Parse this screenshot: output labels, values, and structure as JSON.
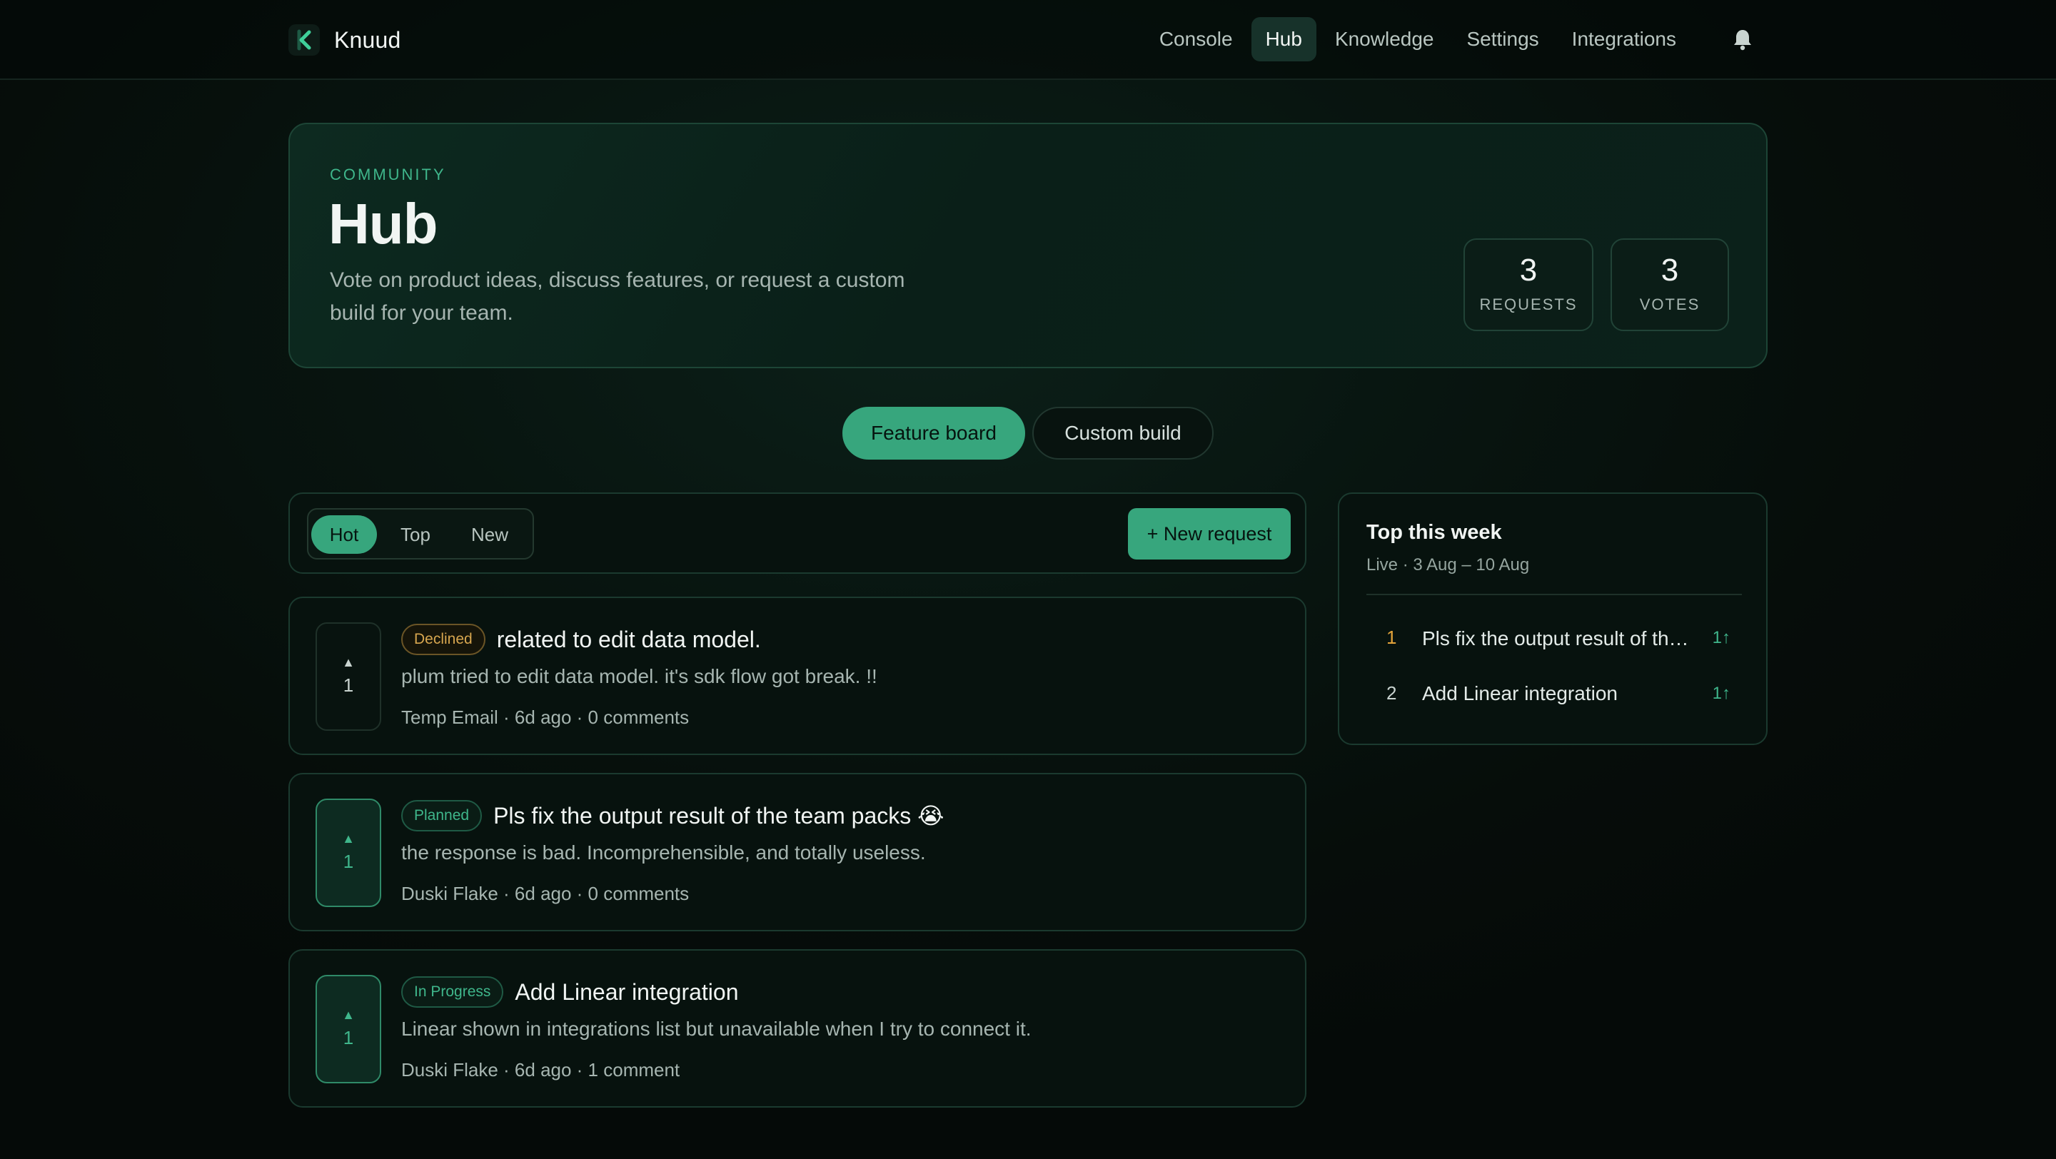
{
  "app": {
    "name": "Knuud"
  },
  "nav": {
    "items": [
      {
        "label": "Console",
        "active": false
      },
      {
        "label": "Hub",
        "active": true
      },
      {
        "label": "Knowledge",
        "active": false
      },
      {
        "label": "Settings",
        "active": false
      },
      {
        "label": "Integrations",
        "active": false
      }
    ],
    "bell_icon": "bell-icon"
  },
  "hero": {
    "eyebrow": "COMMUNITY",
    "title": "Hub",
    "description": "Vote on product ideas, discuss features, or request a custom build for your team.",
    "stats": [
      {
        "value": "3",
        "label": "REQUESTS"
      },
      {
        "value": "3",
        "label": "VOTES"
      }
    ]
  },
  "mode_tabs": [
    {
      "label": "Feature board",
      "active": true
    },
    {
      "label": "Custom build",
      "active": false
    }
  ],
  "toolbar": {
    "sort": [
      {
        "label": "Hot",
        "active": true
      },
      {
        "label": "Top",
        "active": false
      },
      {
        "label": "New",
        "active": false
      }
    ],
    "new_request_label": "+ New request"
  },
  "requests": [
    {
      "status": "Declined",
      "title": "related to edit data model.",
      "body": "plum tried to edit data model. it's sdk flow got break. !!",
      "meta": "Temp Email · 6d ago · 0 comments",
      "votes": "1",
      "vote_arrow": "▲"
    },
    {
      "status": "Planned",
      "title": "Pls fix the output result of the team packs 😭",
      "body": "the response is bad. Incomprehensible, and totally useless.",
      "meta": "Duski Flake · 6d ago · 0 comments",
      "votes": "1",
      "vote_arrow": "▲"
    },
    {
      "status": "In Progress",
      "title": "Add Linear integration",
      "body": "Linear shown in integrations list but unavailable when I try to connect it.",
      "meta": "Duski Flake · 6d ago · 1 comment",
      "votes": "1",
      "vote_arrow": "▲"
    }
  ],
  "top_week": {
    "title": "Top this week",
    "subtitle": "Live · 3 Aug – 10 Aug",
    "items": [
      {
        "rank": "1",
        "title": "Pls fix the output result of the team packs 😭",
        "votes": "1↑"
      },
      {
        "rank": "2",
        "title": "Add Linear integration",
        "votes": "1↑"
      }
    ]
  },
  "colors": {
    "accent": "#37a67d",
    "accent_text": "#3fb68b",
    "declined": "#d7a64f",
    "rank_first": "#e3a43a",
    "background": "#060d0a"
  }
}
